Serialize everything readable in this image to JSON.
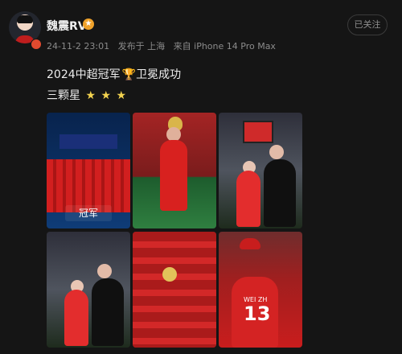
{
  "post": {
    "author": "魏震RV",
    "vip_badge": "★",
    "meta": {
      "time": "24-11-2 23:01",
      "location": "发布于 上海",
      "device": "来自 iPhone 14 Pro Max"
    },
    "follow": "已关注",
    "text_line_1": "2024中超冠军",
    "trophy": "🏆",
    "text_line_1_after": "卫冕成功",
    "text_line_2": "三颗星",
    "stars": [
      "★",
      "★",
      "★"
    ],
    "images": [
      {
        "caption": "冠军",
        "kind": "team-celebration"
      },
      {
        "kind": "player-with-trophy"
      },
      {
        "kind": "stadium-selfie"
      },
      {
        "kind": "player-and-coach"
      },
      {
        "kind": "team-photo"
      },
      {
        "number": "13",
        "name": "WEI ZH",
        "kind": "fan-back-view"
      }
    ]
  }
}
